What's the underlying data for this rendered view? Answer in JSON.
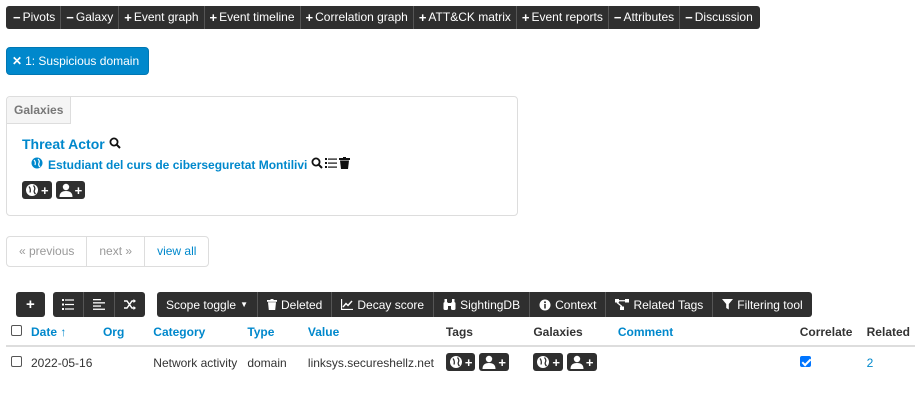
{
  "toggles": [
    {
      "sym": "−",
      "label": "Pivots"
    },
    {
      "sym": "−",
      "label": "Galaxy"
    },
    {
      "sym": "+",
      "label": "Event graph"
    },
    {
      "sym": "+",
      "label": "Event timeline"
    },
    {
      "sym": "+",
      "label": "Correlation graph"
    },
    {
      "sym": "+",
      "label": "ATT&CK matrix"
    },
    {
      "sym": "+",
      "label": "Event reports"
    },
    {
      "sym": "−",
      "label": "Attributes"
    },
    {
      "sym": "−",
      "label": "Discussion"
    }
  ],
  "filter_pill": {
    "label": "1: Suspicious domain"
  },
  "galaxies": {
    "header": "Galaxies",
    "cluster_title": "Threat Actor",
    "cluster_item": "Estudiant del curs de ciberseguretat Montilivi"
  },
  "pagination": {
    "previous": "« previous",
    "next": "next »",
    "view_all": "view all"
  },
  "action_bar": {
    "scope_toggle": "Scope toggle",
    "deleted": "Deleted",
    "decay_score": "Decay score",
    "sightingdb": "SightingDB",
    "context": "Context",
    "related_tags": "Related Tags",
    "filtering_tool": "Filtering tool"
  },
  "table": {
    "headers": {
      "date": "Date ↑",
      "org": "Org",
      "category": "Category",
      "type": "Type",
      "value": "Value",
      "tags": "Tags",
      "galaxies": "Galaxies",
      "comment": "Comment",
      "correlate": "Correlate",
      "related": "Related"
    },
    "rows": [
      {
        "date": "2022-05-16",
        "org": "",
        "category": "Network activity",
        "type": "domain",
        "value": "linksys.secureshellz.net",
        "comment": "",
        "correlate": true,
        "related": "2"
      }
    ]
  },
  "colors": {
    "accent": "#0088cc",
    "dark_bar": "#2f2f2f"
  }
}
